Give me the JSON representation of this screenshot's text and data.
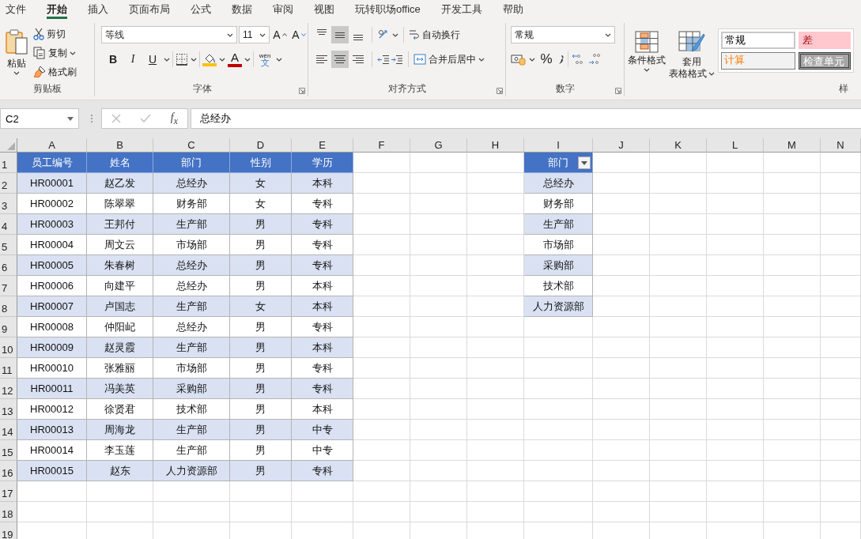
{
  "tabs": [
    {
      "label": "文件",
      "selected": false
    },
    {
      "label": "开始",
      "selected": true
    },
    {
      "label": "插入",
      "selected": false
    },
    {
      "label": "页面布局",
      "selected": false
    },
    {
      "label": "公式",
      "selected": false
    },
    {
      "label": "数据",
      "selected": false
    },
    {
      "label": "审阅",
      "selected": false
    },
    {
      "label": "视图",
      "selected": false
    },
    {
      "label": "玩转职场office",
      "selected": false
    },
    {
      "label": "开发工具",
      "selected": false
    },
    {
      "label": "帮助",
      "selected": false
    }
  ],
  "ribbon": {
    "groups": [
      {
        "kind": "clipboard",
        "label": "剪贴板",
        "paste": "粘贴",
        "commands": [
          "剪切",
          "复制",
          "格式刷"
        ]
      },
      {
        "kind": "font",
        "label": "字体",
        "font_name": "等线",
        "font_size": "11",
        "grow": "A",
        "shrink": "A",
        "styles": [
          "B",
          "I",
          "U"
        ],
        "font_color": "A",
        "phonetic_top": "wén",
        "phonetic_bottom": "文"
      },
      {
        "kind": "alignment",
        "label": "对齐方式",
        "vertical_align": [
          {
            "selected": false
          },
          {
            "selected": true
          },
          {
            "selected": false
          }
        ],
        "horizontal_align": [
          {
            "selected": false
          },
          {
            "selected": true
          },
          {
            "selected": false
          }
        ],
        "commands": [
          "自动换行",
          "合并后居中"
        ]
      },
      {
        "kind": "number",
        "label": "数字",
        "format": "常规",
        "percent": "%"
      },
      {
        "kind": "styles",
        "label": "样",
        "commands": [
          [
            "条件格式"
          ],
          [
            "套用",
            "表格格式"
          ]
        ],
        "cell_styles": [
          {
            "label": "常规",
            "kind": "normal"
          },
          {
            "label": "差",
            "kind": "bad"
          },
          {
            "label": "计算",
            "kind": "calculation"
          },
          {
            "label": "检查单元",
            "kind": "check"
          }
        ]
      }
    ]
  },
  "formula_bar": {
    "name_box": "C2",
    "function_label": "f$_{x}$",
    "formula": "总经办"
  },
  "sheet": {
    "columns": [
      "A",
      "B",
      "C",
      "D",
      "E",
      "F",
      "G",
      "H",
      "I",
      "J",
      "K",
      "L",
      "M",
      "N"
    ],
    "rows": [
      "1",
      "2",
      "3",
      "4",
      "5",
      "6",
      "7",
      "8",
      "9",
      "10",
      "11",
      "12",
      "13",
      "14",
      "15",
      "16",
      "17",
      "18",
      "19"
    ],
    "table": {
      "header": [
        "员工编号",
        "姓名",
        "部门",
        "性别",
        "学历"
      ],
      "rows": [
        [
          "HR00001",
          "赵乙发",
          "总经办",
          "女",
          "本科"
        ],
        [
          "HR00002",
          "陈翠翠",
          "财务部",
          "女",
          "专科"
        ],
        [
          "HR00003",
          "王邦付",
          "生产部",
          "男",
          "专科"
        ],
        [
          "HR00004",
          "周文云",
          "市场部",
          "男",
          "专科"
        ],
        [
          "HR00005",
          "朱春树",
          "总经办",
          "男",
          "专科"
        ],
        [
          "HR00006",
          "向建平",
          "总经办",
          "男",
          "本科"
        ],
        [
          "HR00007",
          "卢国志",
          "生产部",
          "女",
          "本科"
        ],
        [
          "HR00008",
          "仲阳屺",
          "总经办",
          "男",
          "专科"
        ],
        [
          "HR00009",
          "赵灵霞",
          "生产部",
          "男",
          "本科"
        ],
        [
          "HR00010",
          "张雅丽",
          "市场部",
          "男",
          "专科"
        ],
        [
          "HR00011",
          "冯美英",
          "采购部",
          "男",
          "专科"
        ],
        [
          "HR00012",
          "徐贤君",
          "技术部",
          "男",
          "本科"
        ],
        [
          "HR00013",
          "周海龙",
          "生产部",
          "男",
          "中专"
        ],
        [
          "HR00014",
          "李玉莲",
          "生产部",
          "男",
          "中专"
        ],
        [
          "HR00015",
          "赵东",
          "人力资源部",
          "男",
          "专科"
        ]
      ]
    },
    "list": {
      "header": "部门",
      "items": [
        "总经办",
        "财务部",
        "生产部",
        "市场部",
        "采购部",
        "技术部",
        "人力资源部"
      ]
    }
  }
}
